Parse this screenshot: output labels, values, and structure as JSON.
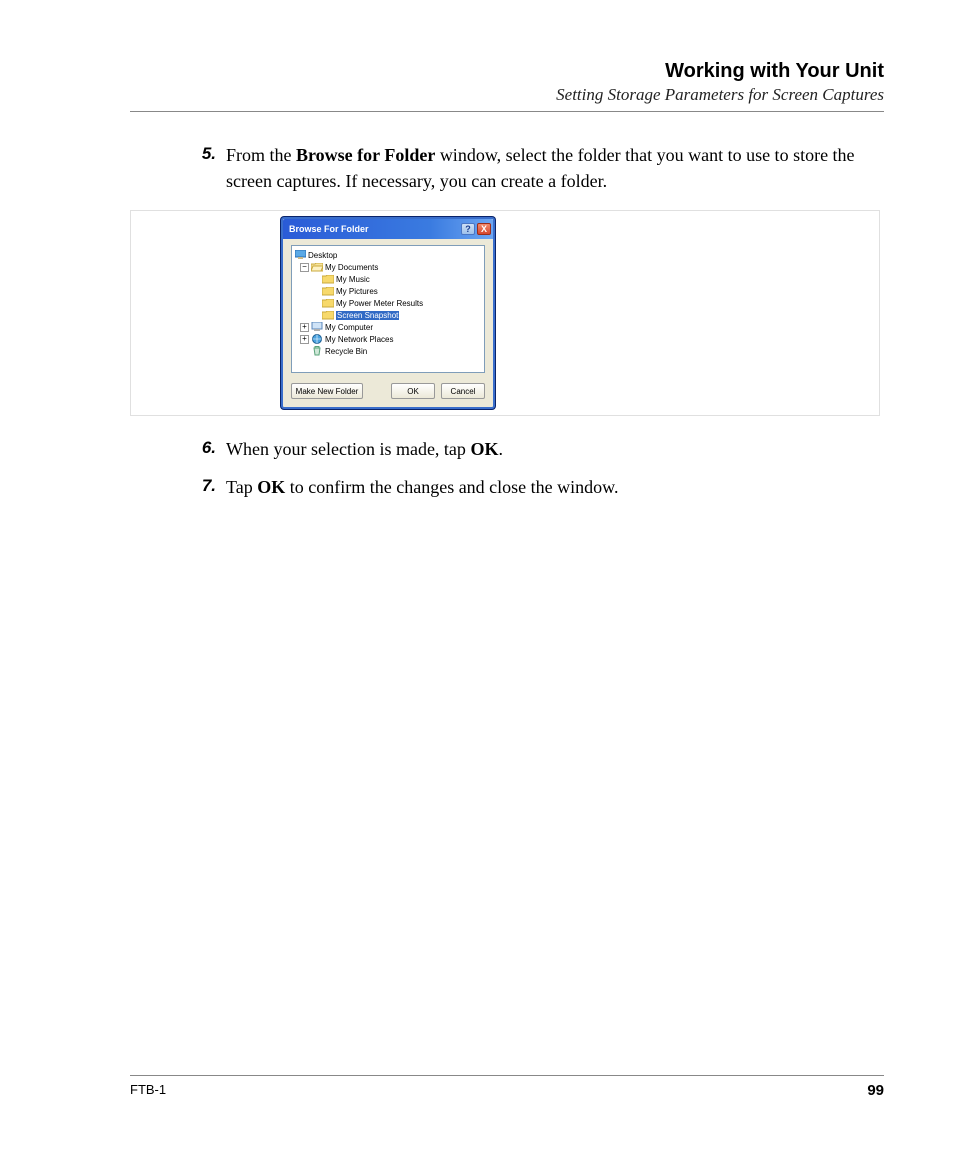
{
  "header": {
    "title": "Working with Your Unit",
    "subtitle": "Setting Storage Parameters for Screen Captures"
  },
  "steps": [
    {
      "num": "5.",
      "pre": "From the ",
      "bold1": "Browse for Folder",
      "post": " window, select the folder that you want to use to store the screen captures. If necessary, you can create a folder."
    },
    {
      "num": "6.",
      "pre": "When your selection is made, tap ",
      "bold1": "OK",
      "post": "."
    },
    {
      "num": "7.",
      "pre": "Tap ",
      "bold1": "OK",
      "post": " to confirm the changes and close the window."
    }
  ],
  "dialog": {
    "title": "Browse For Folder",
    "help": "?",
    "close": "X",
    "tree": {
      "desktop": "Desktop",
      "mydocs": "My Documents",
      "mymusic": "My Music",
      "mypictures": "My Pictures",
      "mypower": "My Power Meter Results",
      "screensnap": "Screen Snapshot",
      "mycomputer": "My Computer",
      "mynetwork": "My Network Places",
      "recycle": "Recycle Bin"
    },
    "buttons": {
      "newfolder": "Make New Folder",
      "ok": "OK",
      "cancel": "Cancel"
    }
  },
  "footer": {
    "left": "FTB-1",
    "right": "99"
  }
}
